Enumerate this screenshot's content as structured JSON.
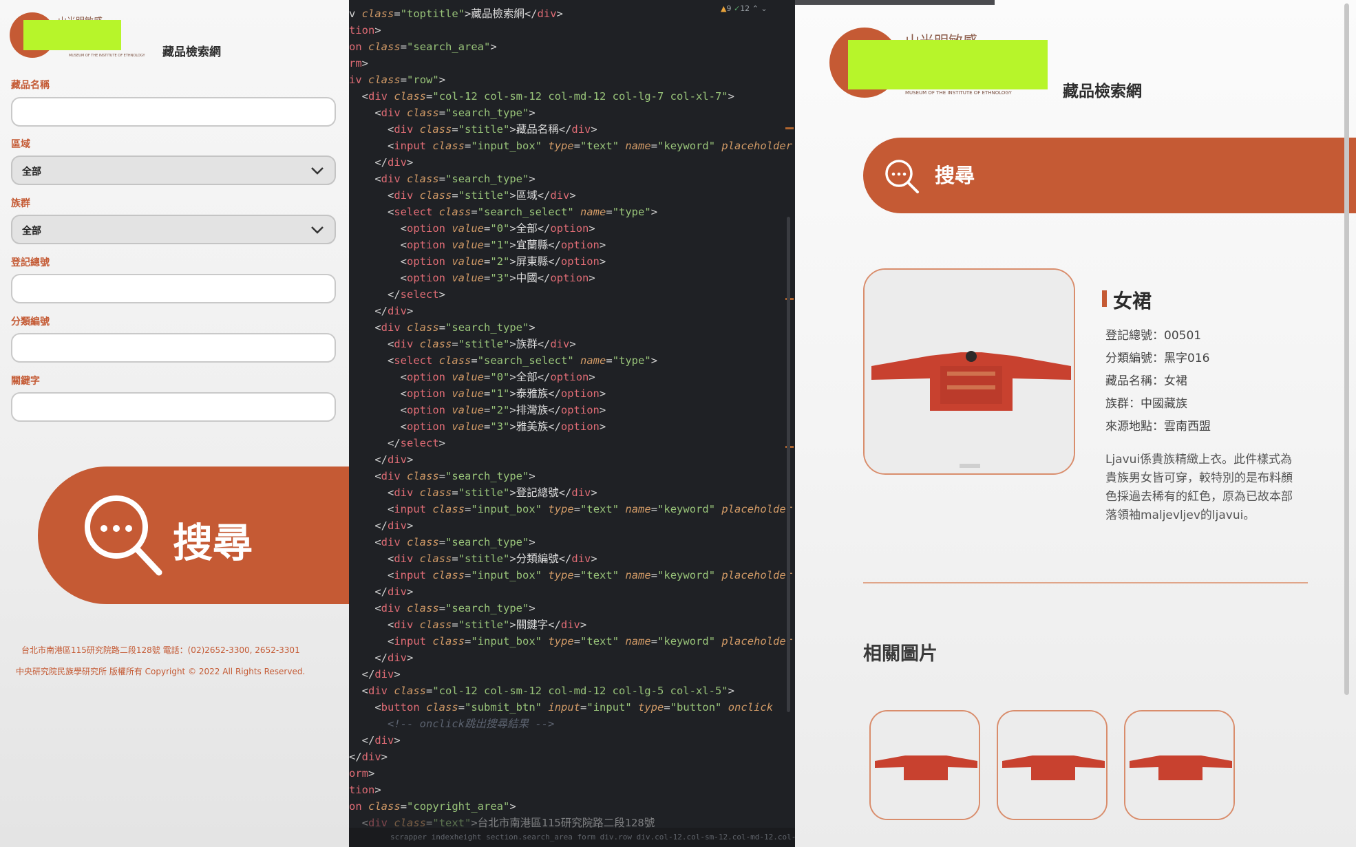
{
  "left": {
    "logo_text": "山光明敏感",
    "logo_small": "MUSEUM OF THE INSTITUTE OF ETHNOLOGY",
    "site_title": "藏品檢索網",
    "fields": [
      {
        "label": "藏品名稱",
        "type": "input",
        "value": ""
      },
      {
        "label": "區域",
        "type": "select",
        "value": "全部"
      },
      {
        "label": "族群",
        "type": "select",
        "value": "全部"
      },
      {
        "label": "登記總號",
        "type": "input",
        "value": ""
      },
      {
        "label": "分類編號",
        "type": "input",
        "value": ""
      },
      {
        "label": "關鍵字",
        "type": "input",
        "value": ""
      }
    ],
    "search_label": "搜尋",
    "footer_address": "台北市南港區115研究院路二段128號 電話：(02)2652-3300, 2652-3301",
    "footer_copyright": "中央研究院民族學研究所 版權所有 Copyright © 2022 All Rights Reserved."
  },
  "editor": {
    "problems": {
      "warnings": "9",
      "ok": "12"
    },
    "status_path": "scrapper indexheight    section.search_area    form    div.row    div.col-12.col-sm-12.col-md-12.col-lg-7.col"
  },
  "right": {
    "logo_text": "山光明敏感",
    "logo_small": "MUSEUM OF THE INSTITUTE OF ETHNOLOGY",
    "site_title": "藏品檢索網",
    "search_label": "搜尋",
    "item": {
      "title": "女裙",
      "meta": [
        "登記總號：00501",
        "分類編號：黑字016",
        "藏品名稱：女裙",
        "族群：中國藏族",
        "來源地點：雲南西盟"
      ],
      "description": "Ljavui係貴族精緻上衣。此件樣式為貴族男女皆可穿，較特別的是布料顏色採過去稀有的紅色，原為已故本部落領袖maljevljev的ljavui。"
    },
    "related_title": "相關圖片"
  },
  "colors": {
    "accent": "#c55a34",
    "editor_bg": "#1f2125"
  }
}
